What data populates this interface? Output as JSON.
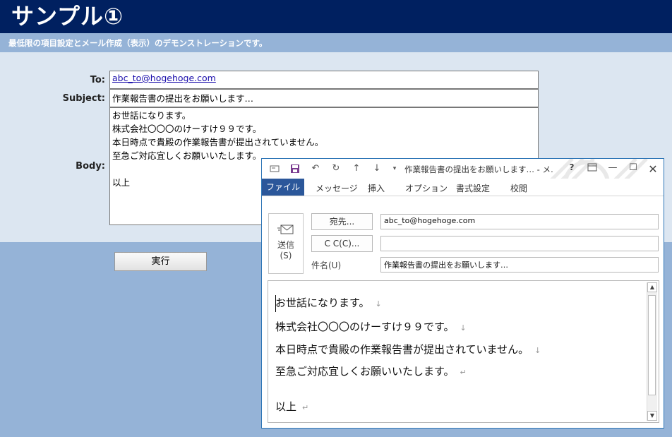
{
  "page": {
    "title": "サンプル①",
    "subtitle": "最低限の項目設定とメール作成（表示）のデモンストレーションです。"
  },
  "form": {
    "to_label": "To:",
    "to_value": "abc_to@hogehoge.com",
    "subject_label": "Subject:",
    "subject_value": "作業報告書の提出をお願いします…",
    "body_label": "Body:",
    "body_value": "お世話になります。\n株式会社〇〇〇のけーすけ９９です。\n本日時点で貴殿の作業報告書が提出されていません。\n至急ご対応宜しくお願いいたします。\n\n以上",
    "run_button": "実行"
  },
  "outlook": {
    "window_title": "作業報告書の提出をお願いします… - メ…",
    "help": "?",
    "ribbon_tabs": [
      "ファイル",
      "メッセージ",
      "挿入",
      "オプション",
      "書式設定",
      "校閲"
    ],
    "send_label": "送信",
    "send_shortcut": "(S)",
    "to_button": "宛先...",
    "cc_button": "C C(C)...",
    "to_value": "abc_to@hogehoge.com",
    "cc_value": "",
    "subject_label": "件名(U)",
    "subject_value": "作業報告書の提出をお願いします…",
    "body_lines": [
      "お世話になります。",
      "株式会社〇〇〇のけーすけ９９です。",
      "本日時点で貴殿の作業報告書が提出されていません。",
      "至急ご対応宜しくお願いいたします。",
      "",
      "以上"
    ],
    "line_marks": [
      "↓",
      "↓",
      "↓",
      "↵",
      "",
      "↵"
    ]
  },
  "colors": {
    "header_bg": "#002060",
    "subbar_bg": "#95b3d7",
    "panel_bg": "#dce6f1",
    "outlook_accent": "#2b579a"
  },
  "icons": {
    "titlebar": [
      "envelope-icon",
      "save-icon",
      "undo-icon",
      "redo-icon",
      "up-arrow-icon",
      "down-arrow-icon",
      "customize-icon"
    ],
    "window_controls": [
      "ribbon-display-icon",
      "minimize-icon",
      "maximize-icon",
      "close-icon"
    ]
  }
}
